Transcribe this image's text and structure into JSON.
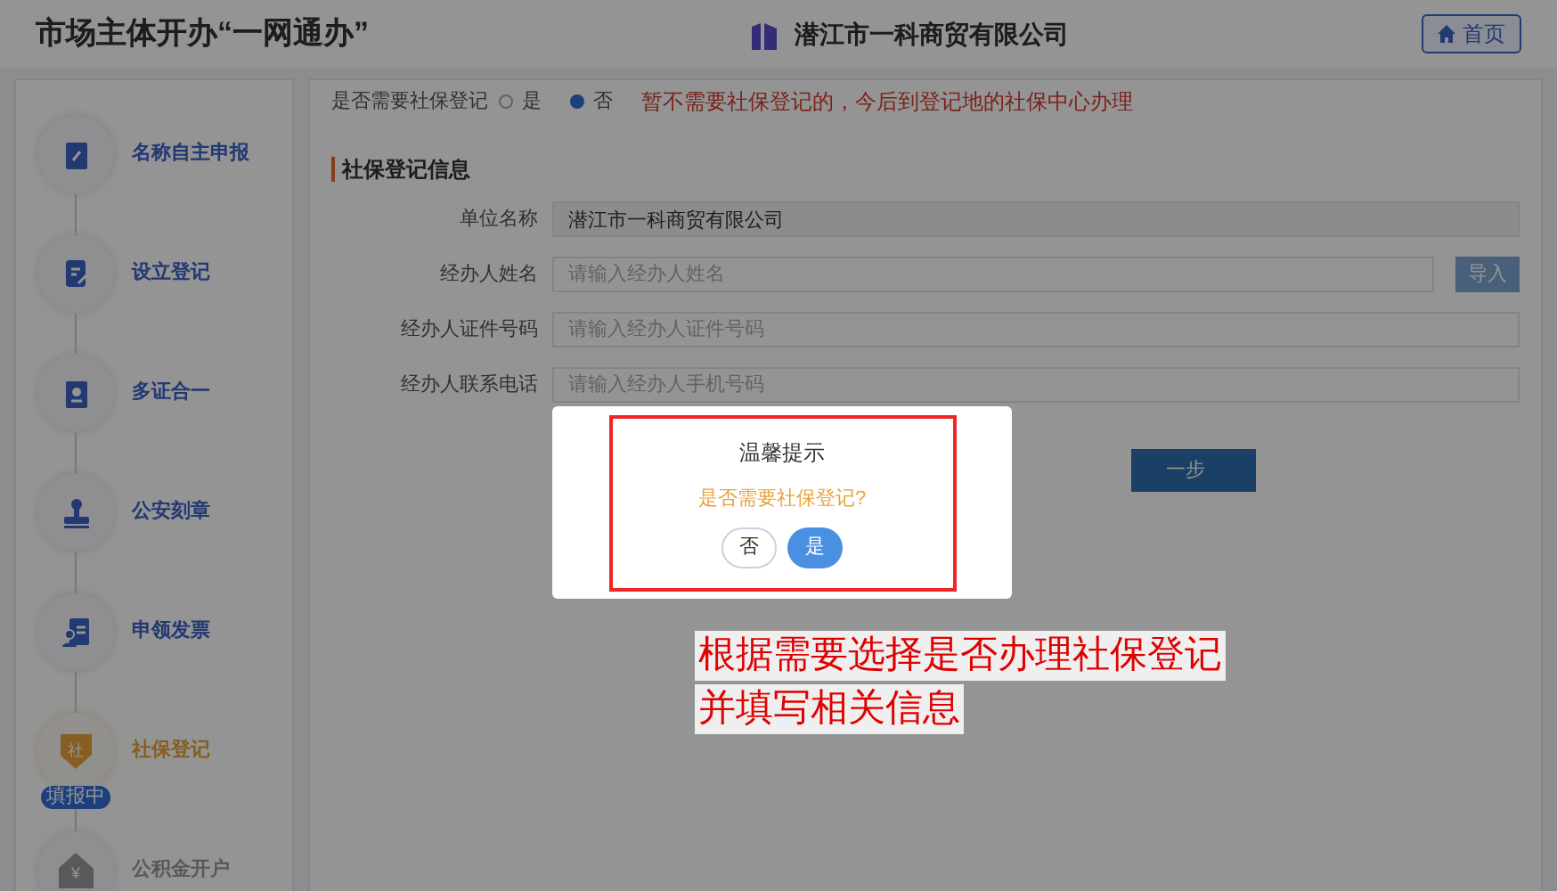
{
  "header": {
    "title": "市场主体开办“一网通办”",
    "company": "潜江市一科商贸有限公司",
    "home_button": "首页"
  },
  "steps": [
    {
      "label": "名称自主申报",
      "kind": "doc",
      "selected": false,
      "disabled": false
    },
    {
      "label": "设立登记",
      "kind": "edit",
      "selected": false,
      "disabled": false
    },
    {
      "label": "多证合一",
      "kind": "card",
      "selected": false,
      "disabled": false
    },
    {
      "label": "公安刻章",
      "kind": "stamp",
      "selected": false,
      "disabled": false
    },
    {
      "label": "申领发票",
      "kind": "invoice",
      "selected": false,
      "disabled": false
    },
    {
      "label": "社保登记",
      "kind": "shield",
      "selected": true,
      "disabled": false,
      "icon_text": "社",
      "badge": "填报中"
    },
    {
      "label": "公积金开户",
      "kind": "house",
      "selected": false,
      "disabled": true,
      "icon_text": "¥"
    }
  ],
  "question": {
    "label": "是否需要社保登记",
    "options": [
      {
        "label": "是",
        "selected": false
      },
      {
        "label": "否",
        "selected": true
      }
    ],
    "notice": "暂不需要社保登记的，今后到登记地的社保中心办理"
  },
  "section": {
    "title": "社保登记信息",
    "fields": [
      {
        "label": "单位名称",
        "value": "潜江市一科商贸有限公司"
      },
      {
        "label": "经办人姓名",
        "placeholder": "请输入经办人姓名",
        "action": "导入"
      },
      {
        "label": "经办人证件号码",
        "placeholder": "请输入经办人证件号码"
      },
      {
        "label": "经办人联系电话",
        "placeholder": "请输入经办人手机号码"
      }
    ],
    "next_button": "一步"
  },
  "dialog": {
    "title": "温馨提示",
    "message": "是否需要社保登记?",
    "buttons": [
      {
        "label": "否",
        "primary": false
      },
      {
        "label": "是",
        "primary": true
      }
    ]
  },
  "annotation": [
    "根据需要选择是否办理社保登记",
    "并填写相关信息"
  ]
}
